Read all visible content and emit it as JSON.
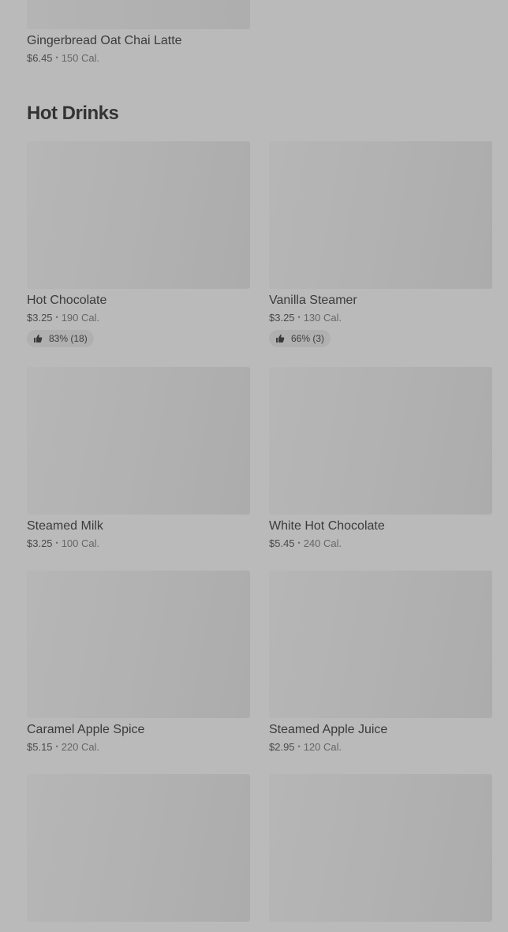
{
  "top_item": {
    "name": "Gingerbread Oat Chai Latte",
    "price": "$6.45",
    "calories": "150 Cal."
  },
  "section": {
    "title": "Hot Drinks"
  },
  "items": [
    {
      "name": "Hot Chocolate",
      "price": "$3.25",
      "calories": "190 Cal.",
      "rating": "83% (18)"
    },
    {
      "name": "Vanilla Steamer",
      "price": "$3.25",
      "calories": "130 Cal.",
      "rating": "66% (3)"
    },
    {
      "name": "Steamed Milk",
      "price": "$3.25",
      "calories": "100 Cal."
    },
    {
      "name": "White Hot Chocolate",
      "price": "$5.45",
      "calories": "240 Cal."
    },
    {
      "name": "Caramel Apple Spice",
      "price": "$5.15",
      "calories": "220 Cal."
    },
    {
      "name": "Steamed Apple Juice",
      "price": "$2.95",
      "calories": "120 Cal."
    }
  ],
  "separator": "•",
  "icons": {
    "rating": "thumbs-up-icon"
  }
}
